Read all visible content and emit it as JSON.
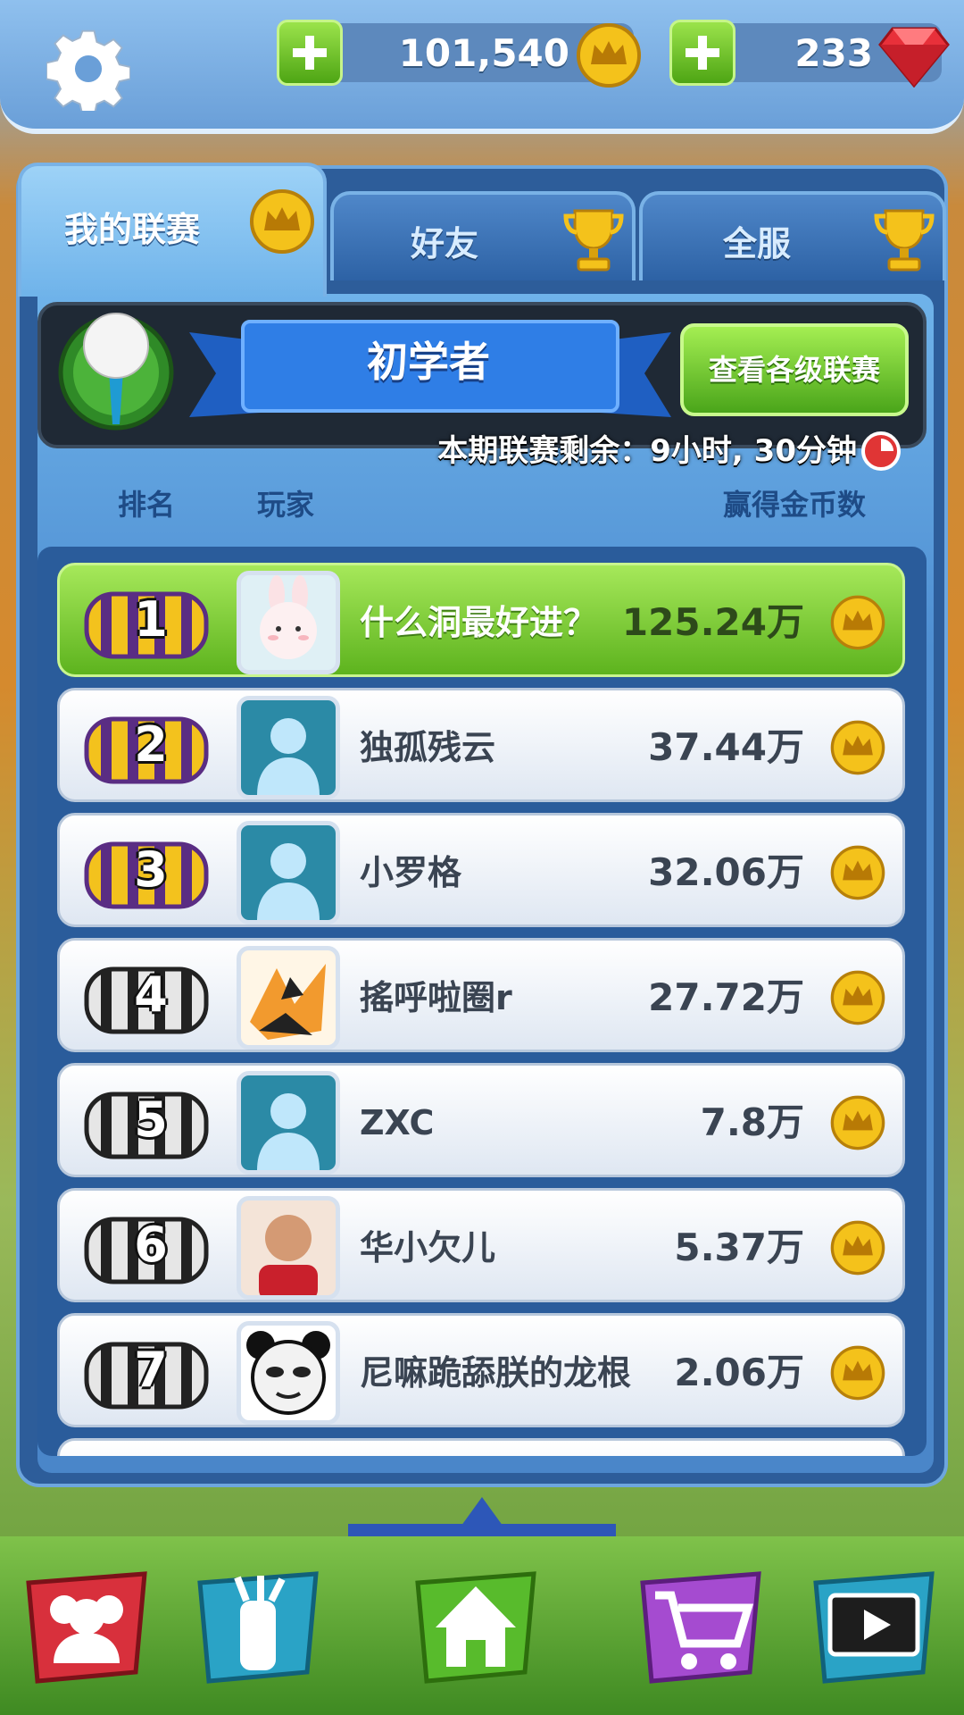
{
  "resources": {
    "coins": "101,540",
    "gems": "233"
  },
  "tabs": [
    {
      "label": "我的联赛",
      "icon": "crown-coin-icon",
      "active": true
    },
    {
      "label": "好友",
      "icon": "trophy-icon",
      "active": false
    },
    {
      "label": "全服",
      "icon": "trophy-icon",
      "active": false
    }
  ],
  "league": {
    "title": "初学者",
    "view_button": "查看各级联赛",
    "countdown": "本期联赛剩余：9小时, 30分钟"
  },
  "columns": {
    "rank": "排名",
    "player": "玩家",
    "coins_won": "赢得金币数"
  },
  "players": [
    {
      "rank": "1",
      "name": "什么洞最好进？",
      "score": "125.24万",
      "chest": "gold"
    },
    {
      "rank": "2",
      "name": "独孤残云",
      "score": "37.44万",
      "chest": "gold"
    },
    {
      "rank": "3",
      "name": "小罗格",
      "score": "32.06万",
      "chest": "gold"
    },
    {
      "rank": "4",
      "name": "搖呼啦圈r",
      "score": "27.72万",
      "chest": "silver"
    },
    {
      "rank": "5",
      "name": "ZXC",
      "score": "7.8万",
      "chest": "silver"
    },
    {
      "rank": "6",
      "name": "华小欠儿",
      "score": "5.37万",
      "chest": "silver"
    },
    {
      "rank": "7",
      "name": "尼嘛跪舔朕的龙根",
      "score": "2.06万",
      "chest": "silver"
    }
  ],
  "nav": [
    "team-icon",
    "golf-bag-icon",
    "home-icon",
    "shop-cart-icon",
    "video-icon"
  ],
  "colors": {
    "accent_green": "#6cc22a",
    "panel_blue": "#2d5d9a",
    "gold": "#f3c21d"
  }
}
